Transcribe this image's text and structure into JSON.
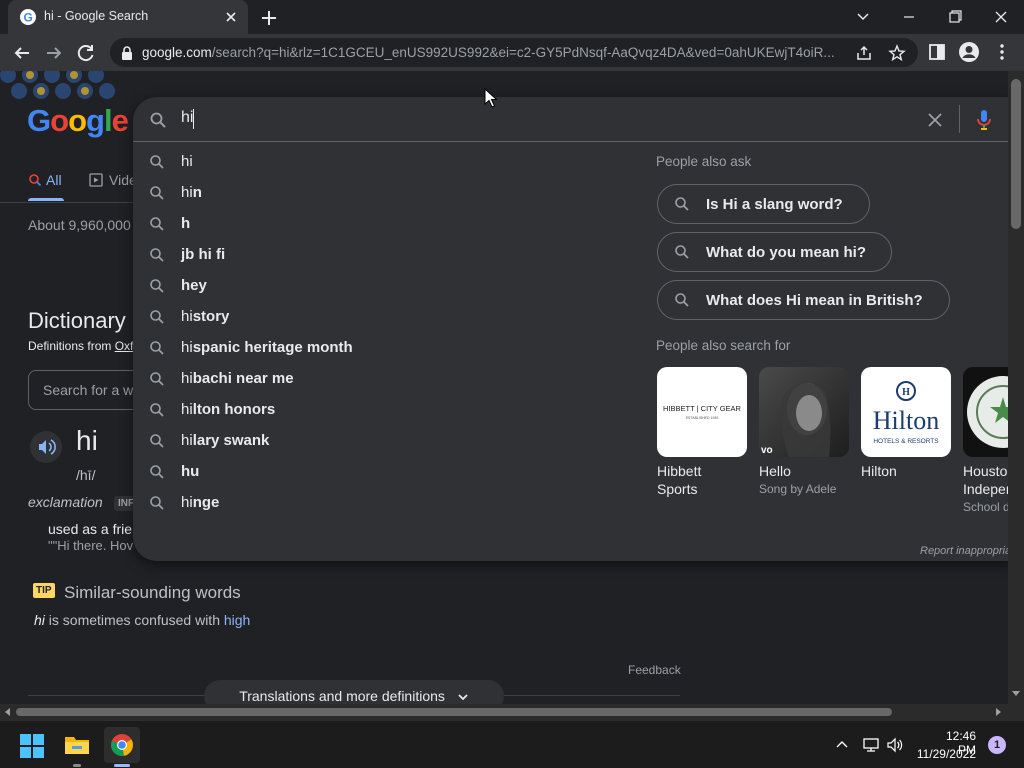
{
  "browser": {
    "tab_title": "hi - Google Search",
    "url_domain": "google.com",
    "url_rest": "/search?q=hi&rlz=1C1GCEU_enUS992US992&ei=c2-GY5PdNsqf-AaQvqz4DA&ved=0ahUKEwjT4oiR..."
  },
  "page": {
    "logo": "Google",
    "nav": {
      "all": "All",
      "videos": "Vide"
    },
    "result_stats": "About 9,960,000",
    "dictionary": {
      "title": "Dictionary",
      "source_prefix": "Definitions from ",
      "source_link": "Oxf",
      "search_placeholder": "Search for a w",
      "word": "hi",
      "pronunciation": "/hī/",
      "part_of_speech": "exclamation",
      "pos_badge": "INF",
      "definition": "used as a frie",
      "example": "\"\"Hi there. Hov"
    },
    "tip": {
      "badge": "TIP",
      "title": "Similar-sounding words",
      "text_word": "hi",
      "text_middle": " is sometimes confused with ",
      "text_link": "high"
    },
    "feedback": "Feedback",
    "more_definitions": "Translations and more definitions"
  },
  "search": {
    "query": "hi",
    "suggestions": [
      {
        "prefix": "hi",
        "rest": ""
      },
      {
        "prefix": "hi",
        "rest": "n"
      },
      {
        "prefix": "h",
        "rest": ""
      },
      {
        "prefix": "jb hi fi",
        "rest": ""
      },
      {
        "prefix": "hey",
        "rest": ""
      },
      {
        "prefix": "hi",
        "rest": "story"
      },
      {
        "prefix": "hi",
        "rest": "spanic heritage month"
      },
      {
        "prefix": "hi",
        "rest": "bachi near me"
      },
      {
        "prefix": "hi",
        "rest": "lton honors"
      },
      {
        "prefix": "hi",
        "rest": "lary swank"
      },
      {
        "prefix": "hu",
        "rest": ""
      },
      {
        "prefix": "hi",
        "rest": "nge"
      }
    ],
    "people_also_ask_title": "People also ask",
    "people_also_ask": [
      "Is Hi a slang word?",
      "What do you mean hi?",
      "What does Hi mean in British?"
    ],
    "people_also_search_title": "People also search for",
    "people_also_search": [
      {
        "name": "Hibbett Sports",
        "sub": "",
        "thumb": "HIBBETT | CITY GEAR"
      },
      {
        "name": "Hello",
        "sub": "Song by Adele",
        "thumb": "vo"
      },
      {
        "name": "Hilton",
        "sub": "",
        "thumb": "Hilton"
      },
      {
        "name": "Housto Indeper",
        "sub": "School d",
        "thumb": ""
      }
    ],
    "report": "Report inappropria"
  },
  "taskbar": {
    "time": "12:46 PM",
    "date": "11/29/2022",
    "notifications": "1"
  },
  "colors": {
    "background": "#202124",
    "dropdown": "#303134",
    "link": "#8ab4f8",
    "tip_badge": "#fdd663"
  }
}
